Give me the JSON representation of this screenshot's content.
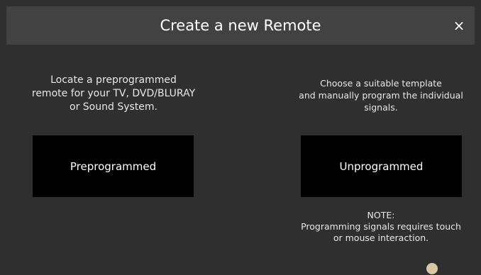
{
  "dialog": {
    "title": "Create a new Remote",
    "close_label": "×"
  },
  "left": {
    "description": "Locate a preprogrammed\nremote for your TV, DVD/BLURAY\nor Sound System.",
    "button_label": "Preprogrammed"
  },
  "right": {
    "description": "Choose a suitable template\nand manually program the individual\nsignals.",
    "button_label": "Unprogrammed",
    "note": "NOTE:\nProgramming signals requires touch\nor mouse interaction."
  },
  "colors": {
    "background": "#2f2f2f",
    "header": "#424242",
    "button": "#000000",
    "text": "#ffffff"
  }
}
